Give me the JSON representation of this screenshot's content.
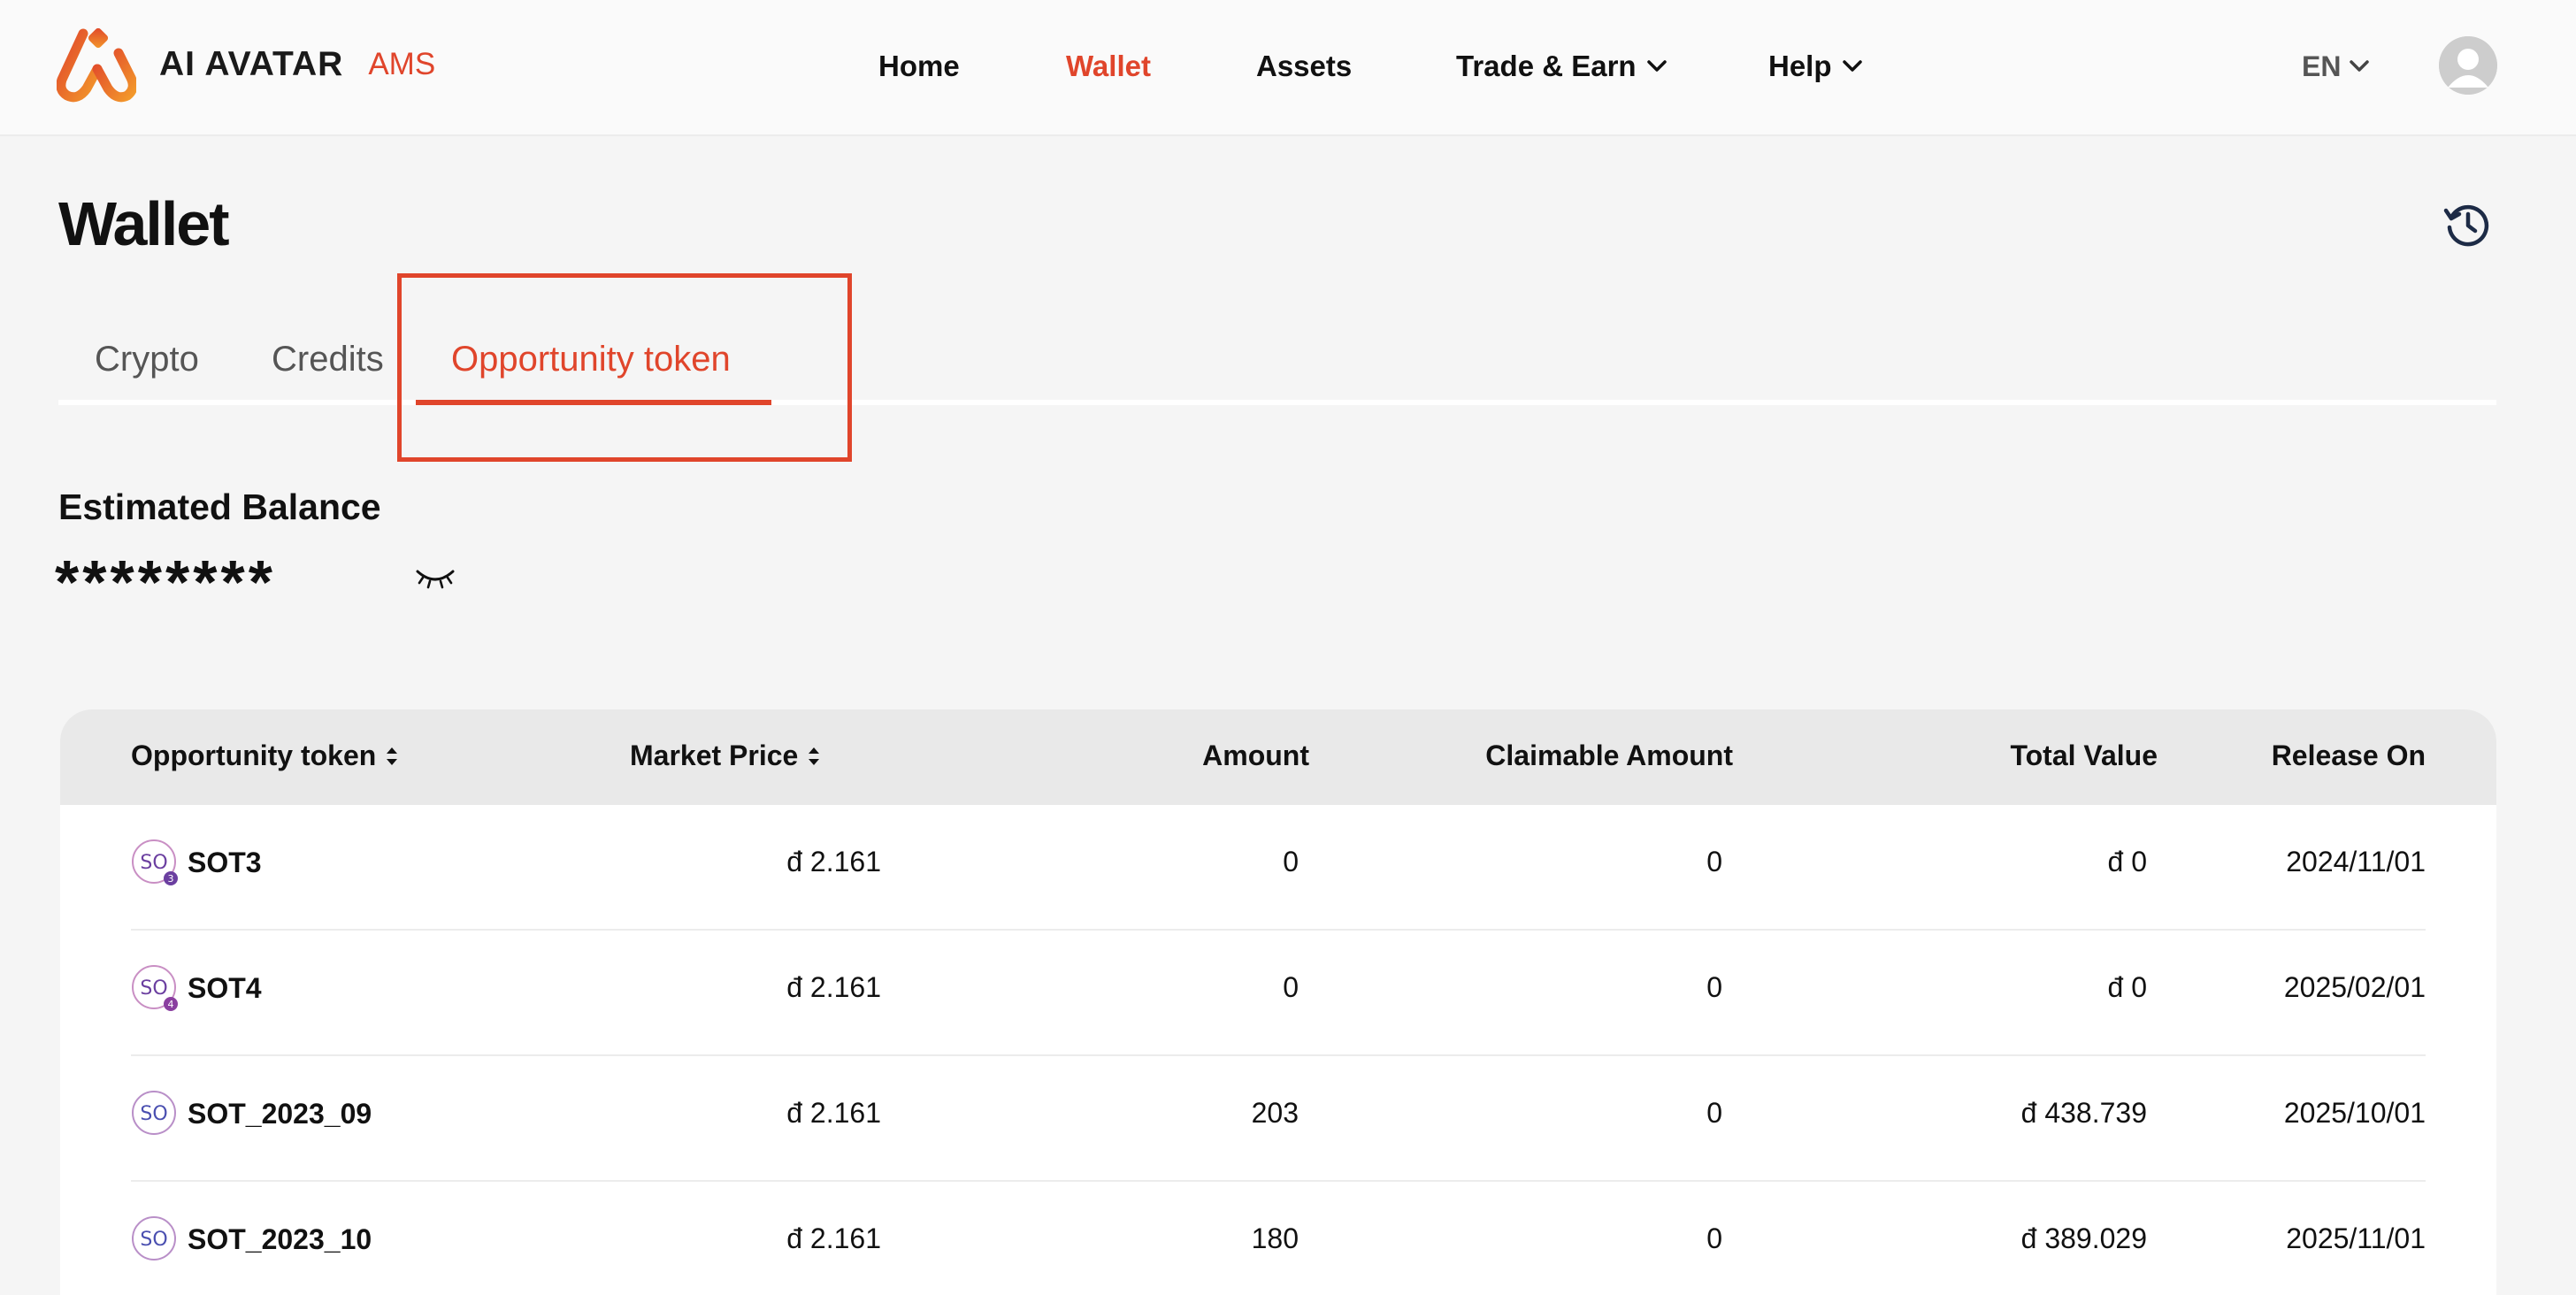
{
  "brand": {
    "name": "AI AVATAR",
    "sub": "AMS"
  },
  "nav": {
    "home": "Home",
    "wallet": "Wallet",
    "assets": "Assets",
    "trade": "Trade & Earn",
    "help": "Help"
  },
  "lang": "EN",
  "page": {
    "title": "Wallet"
  },
  "tabs": {
    "crypto": "Crypto",
    "credits": "Credits",
    "opportunity": "Opportunity token"
  },
  "balance": {
    "label": "Estimated Balance",
    "value": "********"
  },
  "table": {
    "headers": {
      "token": "Opportunity token",
      "price": "Market Price",
      "amount": "Amount",
      "claimable": "Claimable Amount",
      "total": "Total Value",
      "release": "Release On"
    },
    "rows": [
      {
        "badge": "3",
        "token": "SOT3",
        "price": "đ 2.161",
        "amount": "0",
        "claimable": "0",
        "total": "đ 0",
        "release": "2024/11/01"
      },
      {
        "badge": "4",
        "token": "SOT4",
        "price": "đ 2.161",
        "amount": "0",
        "claimable": "0",
        "total": "đ 0",
        "release": "2025/02/01"
      },
      {
        "badge": "",
        "token": "SOT_2023_09",
        "price": "đ 2.161",
        "amount": "203",
        "claimable": "0",
        "total": "đ 438.739",
        "release": "2025/10/01"
      },
      {
        "badge": "",
        "token": "SOT_2023_10",
        "price": "đ 2.161",
        "amount": "180",
        "claimable": "0",
        "total": "đ 389.029",
        "release": "2025/11/01"
      }
    ]
  },
  "colors": {
    "accent": "#e0452b",
    "background": "#f5f5f5",
    "header_row": "#e9e9e9"
  }
}
